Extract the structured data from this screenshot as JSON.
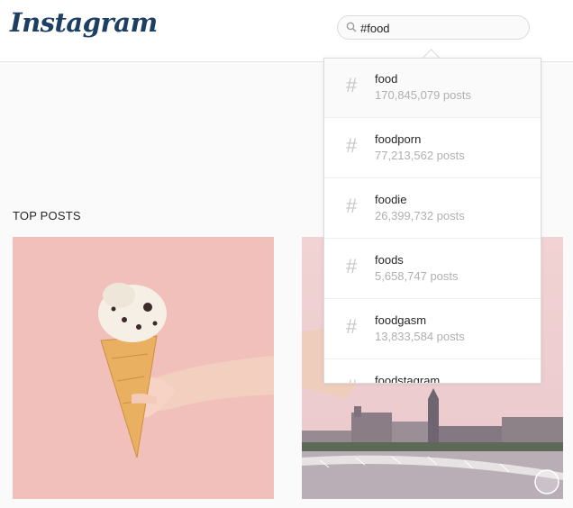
{
  "header": {
    "logo_text": "Instagram"
  },
  "search": {
    "value": "#food"
  },
  "section": {
    "label": "TOP POSTS"
  },
  "dropdown": {
    "items": [
      {
        "name": "food",
        "count": "170,845,079 posts"
      },
      {
        "name": "foodporn",
        "count": "77,213,562 posts"
      },
      {
        "name": "foodie",
        "count": "26,399,732 posts"
      },
      {
        "name": "foods",
        "count": "5,658,747 posts"
      },
      {
        "name": "foodgasm",
        "count": "13,833,584 posts"
      },
      {
        "name": "foodstagram",
        "count": ""
      }
    ],
    "hash_symbol": "#"
  },
  "colors": {
    "brand": "#1c3f63",
    "border": "#dbdbdb",
    "muted": "#b0b0b0"
  }
}
